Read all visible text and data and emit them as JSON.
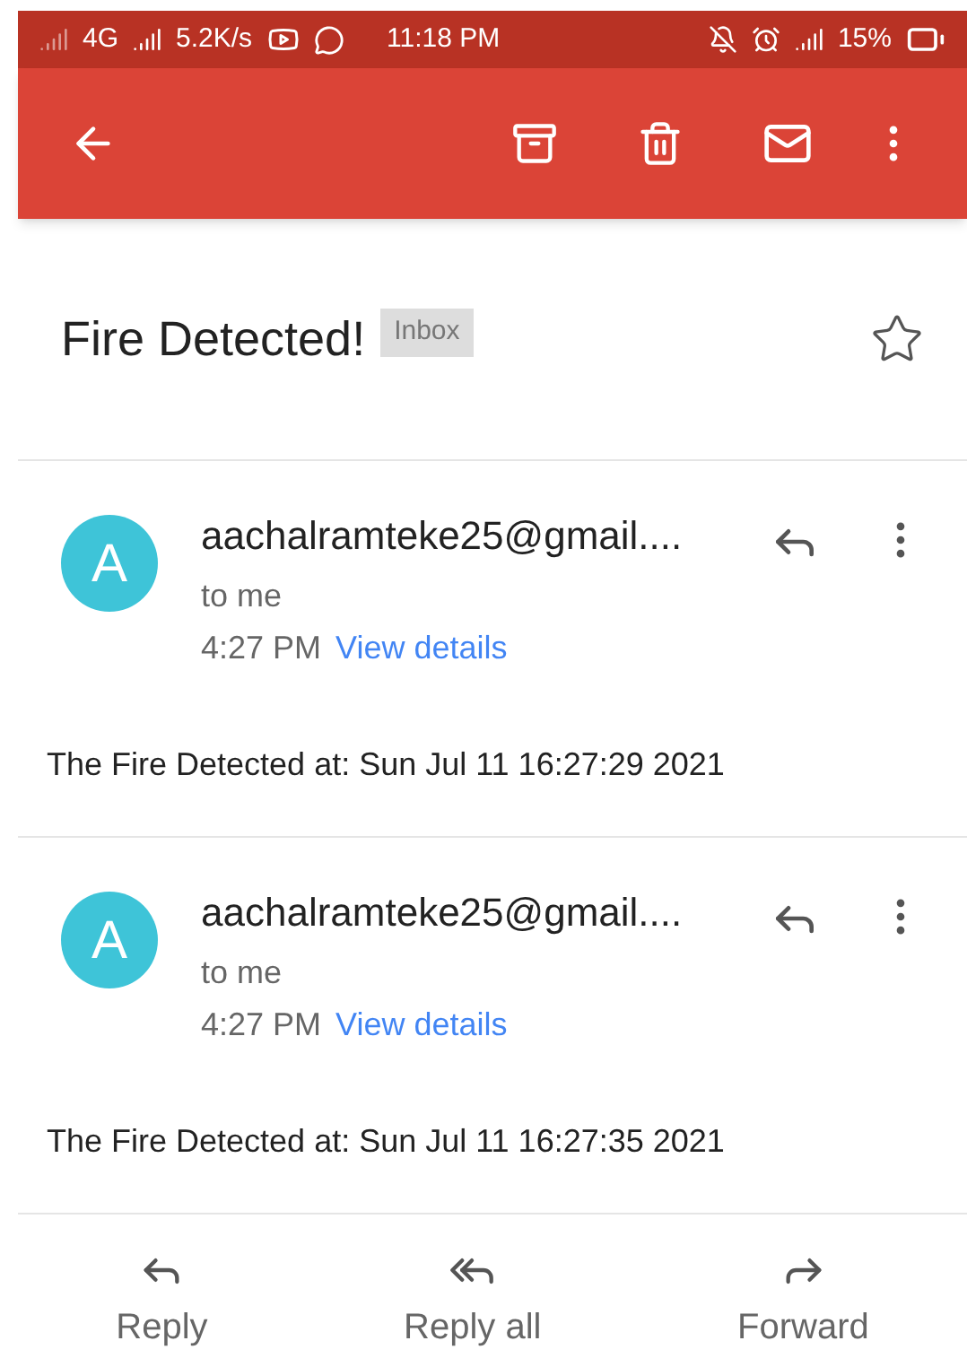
{
  "status_bar": {
    "network": "4G",
    "speed": "5.2K/s",
    "time": "11:18 PM",
    "battery": "15%"
  },
  "subject": {
    "title": "Fire Detected!",
    "label": "Inbox",
    "starred": false
  },
  "messages": [
    {
      "avatar": "A",
      "sender": "aachalramteke25@gmail....",
      "recipient": "to me",
      "time": "4:27 PM",
      "details_link": "View details",
      "body": "The Fire Detected at: Sun Jul 11 16:27:29 2021"
    },
    {
      "avatar": "A",
      "sender": "aachalramteke25@gmail....",
      "recipient": "to me",
      "time": "4:27 PM",
      "details_link": "View details",
      "body": "The Fire Detected at: Sun Jul 11 16:27:35 2021"
    }
  ],
  "actions": [
    {
      "kind": "reply",
      "label": "Reply"
    },
    {
      "kind": "reply_all",
      "label": "Reply all"
    },
    {
      "kind": "forward",
      "label": "Forward"
    }
  ]
}
